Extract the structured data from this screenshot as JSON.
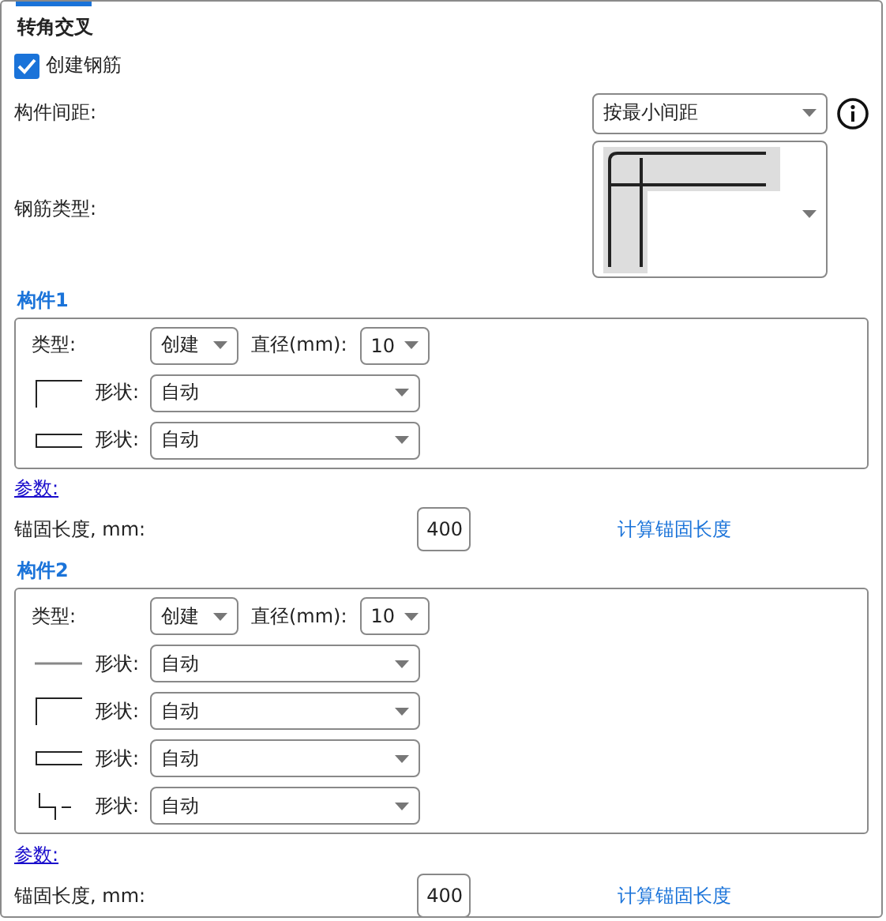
{
  "title": "转角交叉",
  "create_rebar": {
    "label": "创建钢筋",
    "checked": true
  },
  "spacing": {
    "label": "构件间距:",
    "value": "按最小间距"
  },
  "rebar_type": {
    "label": "钢筋类型:"
  },
  "members": [
    {
      "title": "构件1",
      "type_label": "类型:",
      "type_value": "创建",
      "diameter_label": "直径(mm):",
      "diameter_value": "10",
      "shapes": [
        {
          "kind": "hook",
          "label": "形状:",
          "value": "自动"
        },
        {
          "kind": "u",
          "label": "形状:",
          "value": "自动"
        }
      ],
      "params_link": "参数:",
      "anchor_label": "锚固长度, mm:",
      "anchor_value": "400",
      "calc_button": "计算锚固长度"
    },
    {
      "title": "构件2",
      "type_label": "类型:",
      "type_value": "创建",
      "diameter_label": "直径(mm):",
      "diameter_value": "10",
      "shapes": [
        {
          "kind": "straight",
          "label": "形状:",
          "value": "自动"
        },
        {
          "kind": "hook",
          "label": "形状:",
          "value": "自动"
        },
        {
          "kind": "u",
          "label": "形状:",
          "value": "自动"
        },
        {
          "kind": "stirrup",
          "label": "形状:",
          "value": "自动"
        }
      ],
      "params_link": "参数:",
      "anchor_label": "锚固长度, mm:",
      "anchor_value": "400",
      "calc_button": "计算锚固长度"
    }
  ]
}
